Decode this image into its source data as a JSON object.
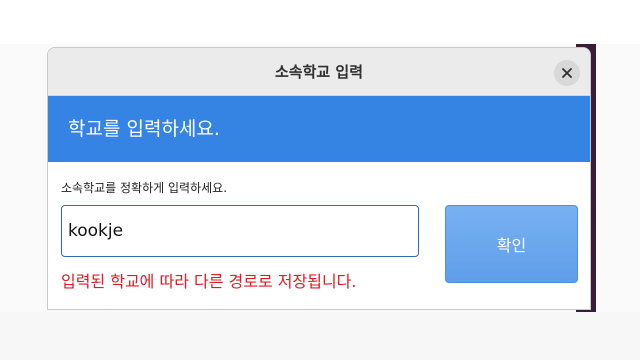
{
  "dialog": {
    "title": "소속학교 입력",
    "close_icon": "close-icon",
    "banner_text": "학교를 입력하세요.",
    "instruction": "소속학교를 정확하게 입력하세요.",
    "school_input": {
      "value": "kookje",
      "placeholder": ""
    },
    "confirm_label": "확인",
    "warning": "입력된 학교에 따라 다른 경로로 저장됩니다."
  },
  "colors": {
    "banner": "#3584e4",
    "confirm_button": "#6aa7ee",
    "warning_text": "#e01b24"
  }
}
